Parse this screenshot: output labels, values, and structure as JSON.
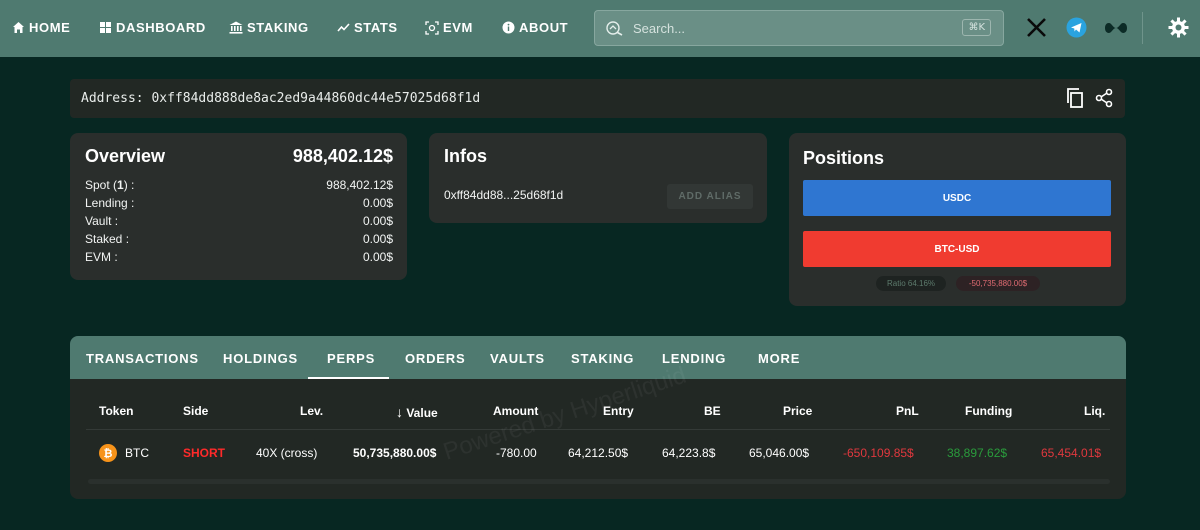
{
  "nav": {
    "items": [
      {
        "label": "HOME",
        "icon": "home-icon"
      },
      {
        "label": "DASHBOARD",
        "icon": "dashboard-icon"
      },
      {
        "label": "STAKING",
        "icon": "bank-icon"
      },
      {
        "label": "STATS",
        "icon": "chart-line-icon"
      },
      {
        "label": "EVM",
        "icon": "evm-icon"
      },
      {
        "label": "ABOUT",
        "icon": "info-icon"
      }
    ],
    "search_placeholder": "Search...",
    "search_shortcut": "⌘K",
    "social": [
      "x-icon",
      "telegram-icon",
      "hyperliquid-icon"
    ],
    "settings_icon": "gear-icon"
  },
  "address": {
    "label": "Address:",
    "value": "0xff84dd888de8ac2ed9a44860dc44e57025d68f1d"
  },
  "overview": {
    "title": "Overview",
    "total": "988,402.12$",
    "rows": [
      {
        "label": "Spot",
        "count": "1",
        "value": "988,402.12$"
      },
      {
        "label": "Lending :",
        "value": "0.00$"
      },
      {
        "label": "Vault :",
        "value": "0.00$"
      },
      {
        "label": "Staked :",
        "value": "0.00$"
      },
      {
        "label": "EVM :",
        "value": "0.00$"
      }
    ]
  },
  "infos": {
    "title": "Infos",
    "short_address": "0xff84dd88...25d68f1d",
    "alias_button": "ADD ALIAS"
  },
  "positions": {
    "title": "Positions",
    "items": [
      {
        "label": "USDC",
        "color": "#2f76d1"
      },
      {
        "label": "BTC-USD",
        "color": "#f03b30"
      }
    ],
    "ratio": "Ratio 64.16%",
    "pnl_badge": "-50,735,880.00$"
  },
  "tabs": {
    "items": [
      "TRANSACTIONS",
      "HOLDINGS",
      "PERPS",
      "ORDERS",
      "VAULTS",
      "STAKING",
      "LENDING",
      "MORE"
    ],
    "active": "PERPS"
  },
  "table": {
    "headers": [
      "Token",
      "Side",
      "Lev.",
      "Value",
      "Amount",
      "Entry",
      "BE",
      "Price",
      "PnL",
      "Funding",
      "Liq."
    ],
    "sort_arrow": "↓",
    "row": {
      "token": "BTC",
      "side": "SHORT",
      "lev": "40X (cross)",
      "value": "50,735,880.00$",
      "amount": "-780.00",
      "entry": "64,212.50$",
      "be": "64,223.8$",
      "price": "65,046.00$",
      "pnl": "-650,109.85$",
      "funding": "38,897.62$",
      "liq": "65,454.01$"
    },
    "watermark": "Powered by Hyperliquid"
  },
  "colors": {
    "nav_bg": "#4f7a70",
    "page_bg": "#072722",
    "card_bg": "#2a2e2c",
    "short": "#ff2a2a",
    "negative": "#e0383e",
    "positive": "#2a9c3c",
    "btc": "#f7931a"
  }
}
